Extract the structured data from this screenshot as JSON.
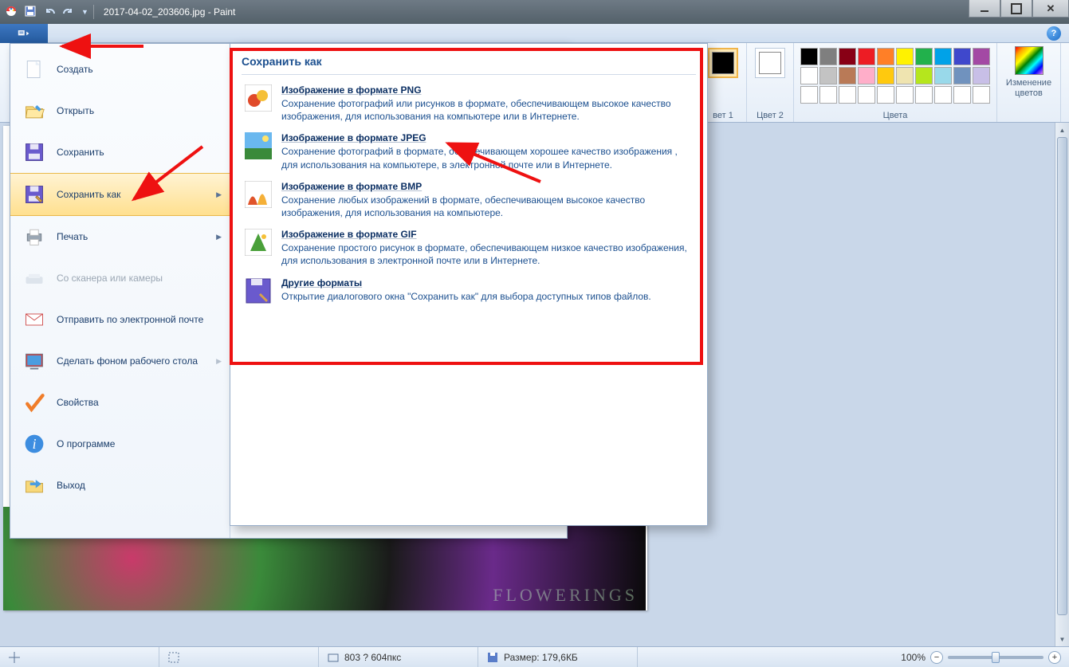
{
  "title": "2017-04-02_203606.jpg - Paint",
  "ribbon": {
    "color1_label": "вет 1",
    "color2_label": "Цвет 2",
    "colors_group": "Цвета",
    "edit_colors": "Изменение цветов",
    "palette_row1": [
      "#000000",
      "#7f7f7f",
      "#880015",
      "#ed1c24",
      "#ff7f27",
      "#fff200",
      "#22b14c",
      "#00a2e8",
      "#3f48cc",
      "#a349a4"
    ],
    "palette_row2": [
      "#ffffff",
      "#c3c3c3",
      "#b97a57",
      "#ffaec9",
      "#ffc90e",
      "#efe4b0",
      "#b5e61d",
      "#99d9ea",
      "#7092be",
      "#c8bfe7"
    ],
    "palette_row3": [
      "#ffffff",
      "#ffffff",
      "#ffffff",
      "#ffffff",
      "#ffffff",
      "#ffffff",
      "#ffffff",
      "#ffffff",
      "#ffffff",
      "#ffffff"
    ]
  },
  "backstage": {
    "items": {
      "new": "Создать",
      "open": "Открыть",
      "save": "Сохранить",
      "save_as": "Сохранить как",
      "print": "Печать",
      "scanner": "Со сканера или камеры",
      "email": "Отправить по электронной почте",
      "wallpaper": "Сделать фоном рабочего стола",
      "properties": "Свойства",
      "about": "О программе",
      "exit": "Выход"
    }
  },
  "submenu": {
    "header": "Сохранить как",
    "png": {
      "title": "Изображение в формате PNG",
      "desc": "Сохранение фотографий или рисунков в формате, обеспечивающем высокое качество изображения, для использования на компьютере или в Интернете."
    },
    "jpeg": {
      "title": "Изображение в формате JPEG",
      "desc": "Сохранение фотографий в формате, обеспечивающем хорошее качество изображения , для использования на компьютере, в электронной почте или в Интернете."
    },
    "bmp": {
      "title": "Изображение в формате BMP",
      "desc": "Сохранение любых изображений в формате, обеспечивающем высокое качество изображения, для использования на компьютере."
    },
    "gif": {
      "title": "Изображение в формате GIF",
      "desc": "Сохранение простого рисунок в формате, обеспечивающем низкое качество изображения, для использования в электронной почте или в Интернете."
    },
    "other": {
      "title": "Другие форматы",
      "desc": "Открытие диалогового окна \"Сохранить как\" для выбора доступных типов файлов."
    }
  },
  "status": {
    "dims": "803 ? 604пкс",
    "size_label": "Размер: 179,6КБ",
    "zoom": "100%"
  },
  "photo_watermark": "FLOWERINGS"
}
